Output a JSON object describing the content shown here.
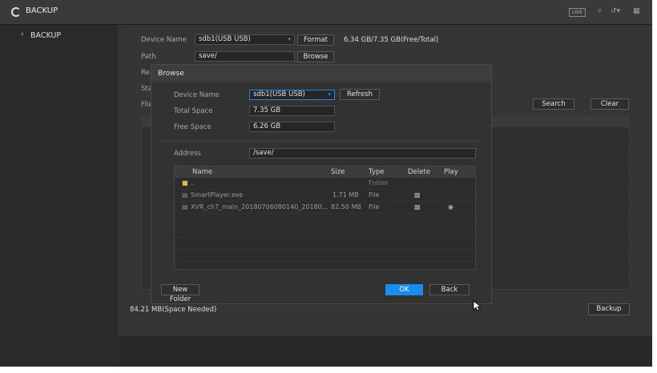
{
  "window": {
    "title": "BACKUP",
    "live_badge": "LIVE",
    "user_icon": "user-icon",
    "logout_icon": "logout-icon",
    "grid_icon": "grid-icon"
  },
  "sidebar": {
    "items": [
      {
        "label": "BACKUP",
        "icon": "chevron-right-icon"
      }
    ]
  },
  "backup": {
    "device_name_label": "Device Name",
    "device_name_value": "sdb1(USB USB)",
    "format_label": "Format",
    "capacity": "6.34 GB/7.35 GB(Free/Total)",
    "path_label": "Path",
    "path_value": "save/",
    "browse_label": "Browse",
    "record_label_partial": "Re",
    "start_label_partial": "Sta",
    "file_label_partial": "File",
    "search_label": "Search",
    "clear_label": "Clear",
    "space_needed": "84.21 MB(Space Needed)",
    "backup_label": "Backup"
  },
  "dialog": {
    "title": "Browse",
    "device_name_label": "Device Name",
    "device_name_value": "sdb1(USB USB)",
    "refresh_label": "Refresh",
    "total_space_label": "Total Space",
    "total_space_value": "7.35 GB",
    "free_space_label": "Free Space",
    "free_space_value": "6.26 GB",
    "address_label": "Address",
    "address_value": "/save/",
    "columns": [
      "Name",
      "Size",
      "Type",
      "Delete",
      "Play"
    ],
    "files": [
      {
        "name": "..",
        "size": "",
        "type": "Folder",
        "icon": "folder-icon",
        "delete_icon": "",
        "play_icon": ""
      },
      {
        "name": "SmartPlayer.exe",
        "size": "1.71 MB",
        "type": "File",
        "icon": "file-icon",
        "delete_icon": "trash-icon",
        "play_icon": ""
      },
      {
        "name": "XVR_ch7_main_20180706080140_20180...",
        "size": "82.50 MB",
        "type": "File",
        "icon": "file-icon",
        "delete_icon": "trash-icon",
        "play_icon": "play-icon"
      }
    ],
    "new_folder_label": "New Folder",
    "ok_label": "OK",
    "back_label": "Back"
  }
}
